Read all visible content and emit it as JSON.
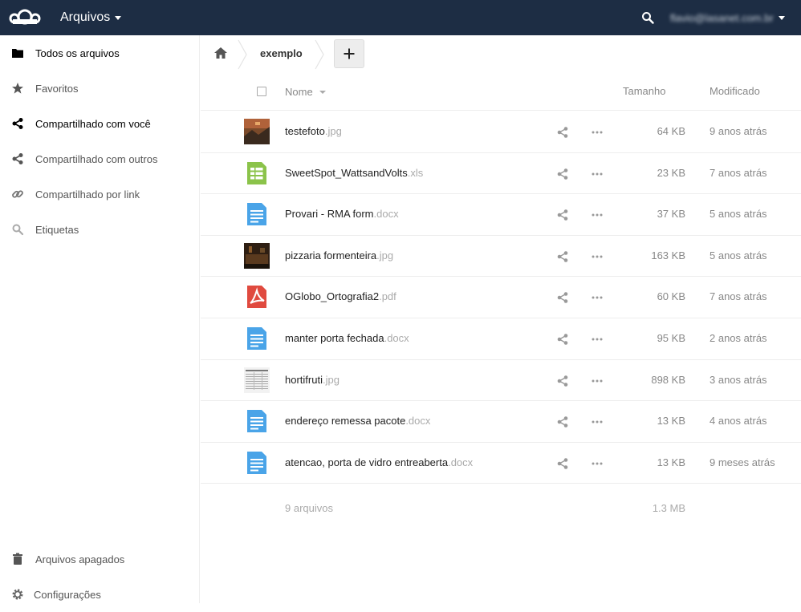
{
  "header": {
    "app_name": "Arquivos",
    "user_email": "flavio@lasanet.com.br"
  },
  "sidebar": {
    "items": [
      {
        "label": "Todos os arquivos",
        "icon": "folder-icon"
      },
      {
        "label": "Favoritos",
        "icon": "star-icon"
      },
      {
        "label": "Compartilhado com você",
        "icon": "share-icon"
      },
      {
        "label": "Compartilhado com outros",
        "icon": "share-icon"
      },
      {
        "label": "Compartilhado por link",
        "icon": "link-icon"
      },
      {
        "label": "Etiquetas",
        "icon": "tag-search-icon"
      }
    ],
    "trash_label": "Arquivos apagados",
    "settings_label": "Configurações"
  },
  "breadcrumb": {
    "folder": "exemplo",
    "new_label": "+"
  },
  "table": {
    "headers": {
      "name": "Nome",
      "size": "Tamanho",
      "modified": "Modificado"
    },
    "files": [
      {
        "base": "testefoto",
        "ext": ".jpg",
        "size": "64 KB",
        "modified": "9 anos atrás",
        "icon": "image-thumbnail"
      },
      {
        "base": "SweetSpot_WattsandVolts",
        "ext": ".xls",
        "size": "23 KB",
        "modified": "7 anos atrás",
        "icon": "spreadsheet-icon"
      },
      {
        "base": "Provari - RMA form",
        "ext": ".docx",
        "size": "37 KB",
        "modified": "5 anos atrás",
        "icon": "document-icon"
      },
      {
        "base": "pizzaria formenteira",
        "ext": ".jpg",
        "size": "163 KB",
        "modified": "5 anos atrás",
        "icon": "image-thumbnail"
      },
      {
        "base": "OGlobo_Ortografia2",
        "ext": ".pdf",
        "size": "60 KB",
        "modified": "7 anos atrás",
        "icon": "pdf-icon"
      },
      {
        "base": "manter porta fechada",
        "ext": ".docx",
        "size": "95 KB",
        "modified": "2 anos atrás",
        "icon": "document-icon"
      },
      {
        "base": "hortifruti",
        "ext": ".jpg",
        "size": "898 KB",
        "modified": "3 anos atrás",
        "icon": "image-thumbnail"
      },
      {
        "base": "endereço remessa pacote",
        "ext": ".docx",
        "size": "13 KB",
        "modified": "4 anos atrás",
        "icon": "document-icon"
      },
      {
        "base": "atencao, porta de vidro entreaberta",
        "ext": ".docx",
        "size": "13 KB",
        "modified": "9 meses atrás",
        "icon": "document-icon"
      }
    ],
    "summary": {
      "count": "9 arquivos",
      "total": "1.3 MB"
    }
  },
  "colors": {
    "header_bg": "#1d2d44",
    "doc_blue": "#4aa4e8",
    "sheet_green": "#8bc34a",
    "pdf_red": "#e04a3f"
  }
}
